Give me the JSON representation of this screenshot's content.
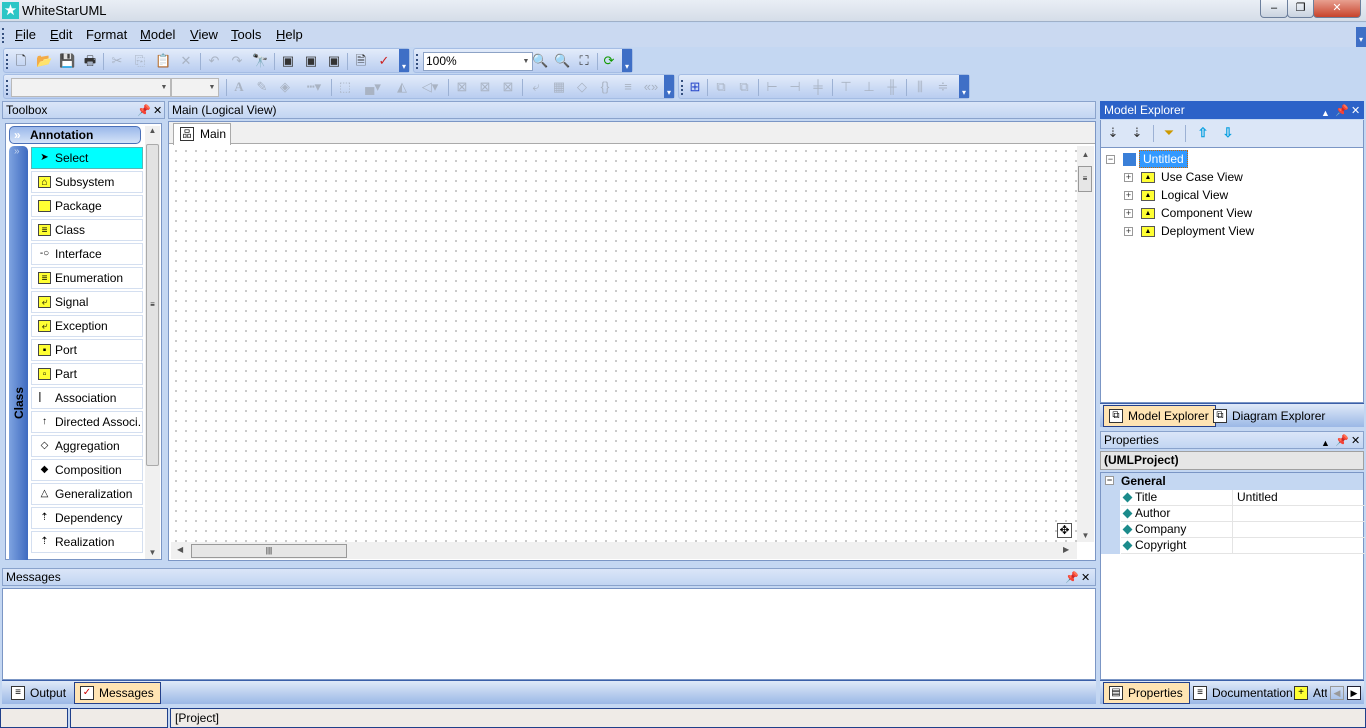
{
  "app": {
    "title": "WhiteStarUML"
  },
  "menu": [
    "File",
    "Edit",
    "Format",
    "Model",
    "View",
    "Tools",
    "Help"
  ],
  "menu_accel": [
    "F",
    "E",
    "o",
    "M",
    "V",
    "T",
    "H"
  ],
  "toolbar": {
    "zoom": "100%",
    "font_name": "",
    "font_size": ""
  },
  "toolbox": {
    "title": "Toolbox",
    "category": "Annotation",
    "side_label": "Class",
    "items": [
      {
        "label": "Select",
        "icon": "pointer-icon"
      },
      {
        "label": "Subsystem",
        "icon": "subsystem-icon"
      },
      {
        "label": "Package",
        "icon": "package-icon"
      },
      {
        "label": "Class",
        "icon": "class-icon"
      },
      {
        "label": "Interface",
        "icon": "interface-icon"
      },
      {
        "label": "Enumeration",
        "icon": "enumeration-icon"
      },
      {
        "label": "Signal",
        "icon": "signal-icon"
      },
      {
        "label": "Exception",
        "icon": "exception-icon"
      },
      {
        "label": "Port",
        "icon": "port-icon"
      },
      {
        "label": "Part",
        "icon": "part-icon"
      },
      {
        "label": "Association",
        "icon": "association-icon"
      },
      {
        "label": "Directed Associ...",
        "icon": "directed-association-icon"
      },
      {
        "label": "Aggregation",
        "icon": "aggregation-icon"
      },
      {
        "label": "Composition",
        "icon": "composition-icon"
      },
      {
        "label": "Generalization",
        "icon": "generalization-icon"
      },
      {
        "label": "Dependency",
        "icon": "dependency-icon"
      },
      {
        "label": "Realization",
        "icon": "realization-icon"
      }
    ]
  },
  "diagram": {
    "title": "Main (Logical View)",
    "tab": "Main"
  },
  "explorer": {
    "title": "Model Explorer",
    "root": "Untitled",
    "children": [
      "Use Case View",
      "Logical View",
      "Component View",
      "Deployment View"
    ],
    "tabs": [
      "Model Explorer",
      "Diagram Explorer"
    ]
  },
  "properties": {
    "title": "Properties",
    "object": "(UMLProject)",
    "group": "General",
    "rows": [
      {
        "key": "Title",
        "value": "Untitled"
      },
      {
        "key": "Author",
        "value": ""
      },
      {
        "key": "Company",
        "value": ""
      },
      {
        "key": "Copyright",
        "value": ""
      }
    ],
    "tabs": [
      "Properties",
      "Documentation",
      "Att"
    ]
  },
  "messages": {
    "title": "Messages",
    "tabs": [
      "Output",
      "Messages"
    ]
  },
  "statusbar": [
    "",
    "",
    "[Project]"
  ]
}
